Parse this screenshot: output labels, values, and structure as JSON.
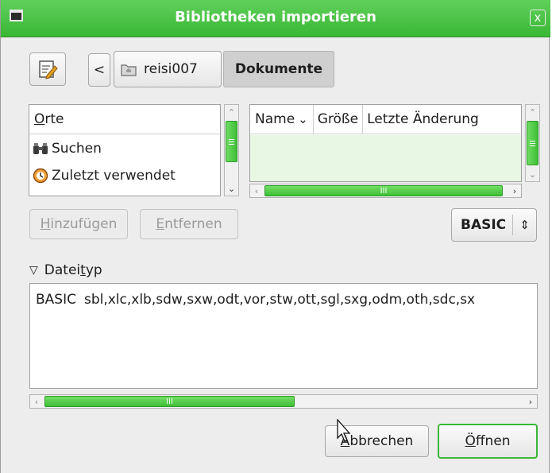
{
  "window": {
    "title": "Bibliotheken importieren",
    "close_glyph": "x"
  },
  "toolbar": {
    "edit_icon": "edit-path-icon",
    "back_glyph": "<",
    "path": [
      {
        "label": "reisi007",
        "icon": "home-folder-icon"
      },
      {
        "label": "Dokumente"
      }
    ]
  },
  "places": {
    "header": "Orte",
    "header_mnemonic": "O",
    "header_rest": "rte",
    "items": [
      {
        "label": "Suchen",
        "icon": "binoculars-icon"
      },
      {
        "label": "Zuletzt verwendet",
        "icon": "recent-clock-icon"
      }
    ]
  },
  "files": {
    "columns": [
      "Name",
      "Größe",
      "Letzte Änderung"
    ],
    "sort_glyph": "⌄",
    "scroll_grip": "III"
  },
  "buttons": {
    "add": {
      "pre": "",
      "mn": "H",
      "post": "inzufügen"
    },
    "remove": {
      "pre": "",
      "mn": "E",
      "post": "ntfernen"
    },
    "cancel": {
      "pre": "",
      "mn": "A",
      "post": "bbrechen"
    },
    "open": {
      "pre": "",
      "mn": "Ö",
      "post": "ffnen"
    }
  },
  "filter": {
    "selected": "BASIC",
    "glyph": "⇕"
  },
  "filetype": {
    "expander_glyph": "▽",
    "label_pre": "Datei",
    "label_mn": "t",
    "label_post": "yp",
    "rows": [
      {
        "name": "BASIC",
        "extensions": "sbl,xlc,xlb,sdw,sxw,odt,vor,stw,ott,sgl,sxg,odm,oth,sdc,sx"
      }
    ],
    "scroll_grip": "III"
  },
  "colors": {
    "accent": "#3ab735",
    "title_text": "#ffffff"
  }
}
